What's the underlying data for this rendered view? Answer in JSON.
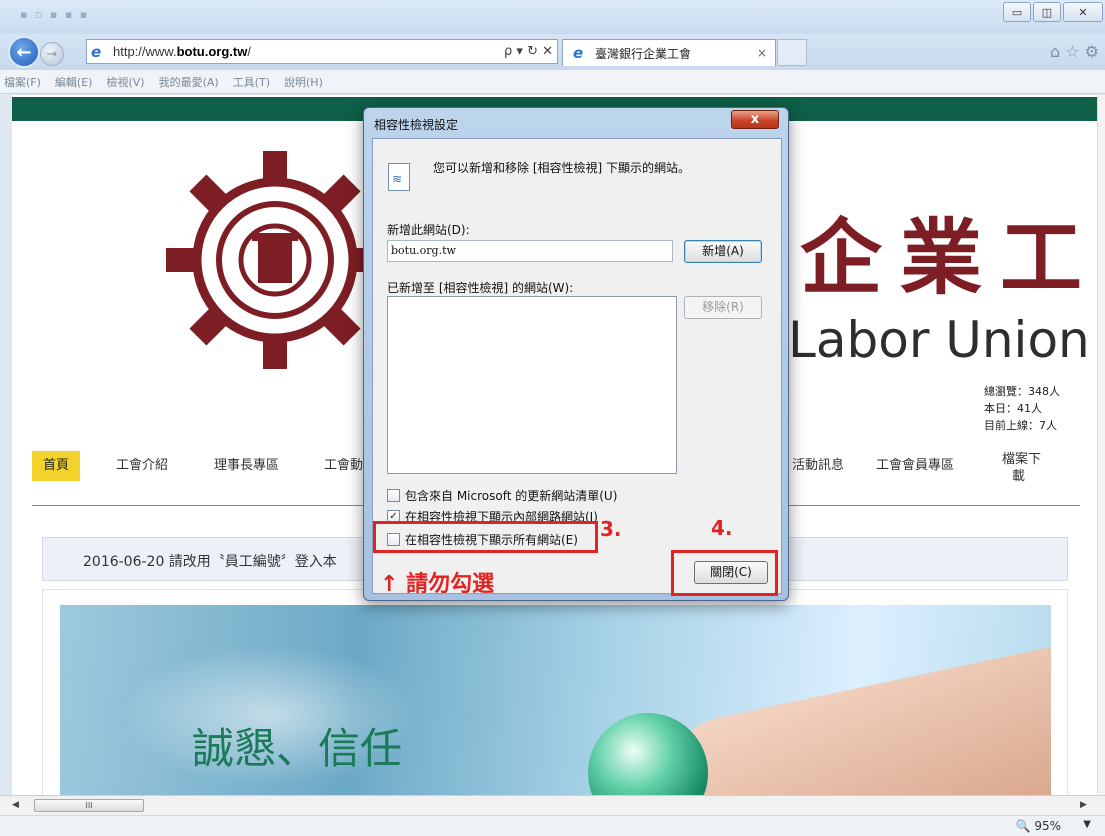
{
  "browser": {
    "url_prefix": "http://www.",
    "url_domain": "botu.org.tw",
    "url_suffix": "/",
    "tab_title": "臺灣銀行企業工會",
    "tab_close": "×",
    "address_tools": "ρ ▾ ↻ ✕",
    "win_min": "▭",
    "win_max": "◫",
    "win_close": "✕",
    "tools_icons": "⌂ ☆ ⚙",
    "menu": [
      "檔案(F)",
      "編輯(E)",
      "檢視(V)",
      "我的最愛(A)",
      "工具(T)",
      "說明(H)"
    ],
    "zoom": "95%",
    "hscroll_thumb": "III"
  },
  "site": {
    "logo_text": "企業工會",
    "logo_en": "Labor Union",
    "stats": {
      "total": "總瀏覽：348人",
      "today": "本日：41人",
      "online": "目前上線：7人"
    },
    "nav": {
      "home": "首頁",
      "intro": "工會介紹",
      "chairman": "理事長專區",
      "union": "工會動",
      "activities": "活動訊息",
      "members": "工會會員專區",
      "download_line1": "檔案下",
      "download_line2": "載"
    },
    "news": "2016-06-20 請改用〝員工編號〞登入本",
    "slogan": "誠懇、信任"
  },
  "dialog": {
    "title": "相容性檢視設定",
    "close": "x",
    "description": "您可以新增和移除 [相容性檢視] 下顯示的網站。",
    "add_label": "新增此網站(D):",
    "add_value": "botu.org.tw",
    "add_button": "新增(A)",
    "list_label": "已新增至 [相容性檢視] 的網站(W):",
    "remove_button": "移除(R)",
    "checkbox1": "包含來自 Microsoft 的更新網站清單(U)",
    "checkbox2": "在相容性檢視下顯示內部網路網站(I)",
    "checkbox3": "在相容性檢視下顯示所有網站(E)",
    "checkbox2_mark": "✓",
    "close_button": "關閉(C)"
  },
  "annotations": {
    "step3": "3.",
    "step4": "4.",
    "warning": "↑  請勿勾選"
  }
}
